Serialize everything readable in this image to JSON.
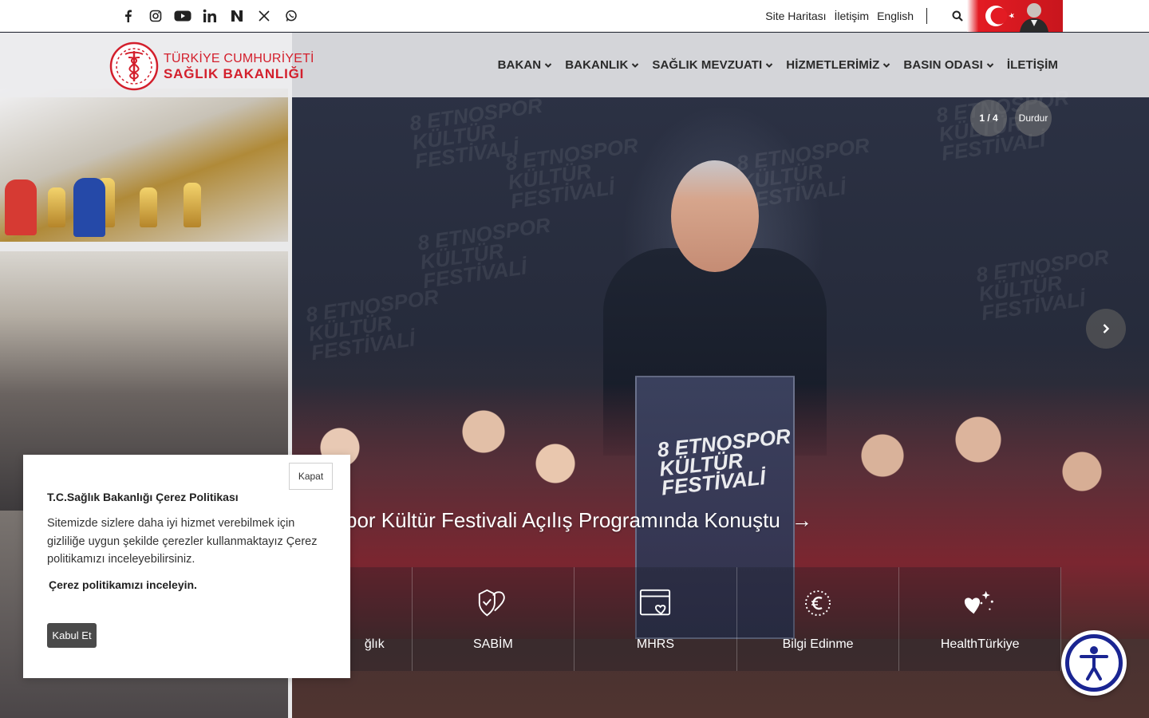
{
  "social": {
    "icons": [
      "facebook-icon",
      "instagram-icon",
      "youtube-icon",
      "linkedin-icon",
      "nsosyal-icon",
      "x-icon",
      "whatsapp-icon"
    ]
  },
  "toplinks": {
    "sitemap": "Site Haritası",
    "contact": "İletişim",
    "english": "English"
  },
  "logo": {
    "line1": "TÜRKİYE CUMHURİYETİ",
    "line2": "SAĞLIK BAKANLIĞI",
    "color": "#d31f2c"
  },
  "nav": {
    "items": [
      {
        "label": "BAKAN",
        "dropdown": true
      },
      {
        "label": "BAKANLIK",
        "dropdown": true
      },
      {
        "label": "SAĞLIK MEVZUATI",
        "dropdown": true
      },
      {
        "label": "HİZMETLERİMİZ",
        "dropdown": true
      },
      {
        "label": "BASIN ODASI",
        "dropdown": true
      },
      {
        "label": "İLETİŞİM",
        "dropdown": false
      }
    ]
  },
  "slider": {
    "counter": "1 / 4",
    "pause_label": "Durdur",
    "caption": "spor Kültür Festivali Açılış Programında Konuştu",
    "caption_arrow": "→"
  },
  "quicklinks": [
    {
      "label": "ğlık",
      "icon": "health-icon"
    },
    {
      "label": "SABİM",
      "icon": "shield-heart-icon"
    },
    {
      "label": "MHRS",
      "icon": "calendar-heart-icon"
    },
    {
      "label": "Bilgi Edinme",
      "icon": "info-c-icon"
    },
    {
      "label": "HealthTürkiye",
      "icon": "star-heart-icon"
    }
  ],
  "cookie": {
    "close_label": "Kapat",
    "title": "T.C.Sağlık Bakanlığı Çerez Politikası",
    "text": "Sitemizde sizlere daha iyi hizmet verebilmek için gizliliğe uygun şekilde çerezler kullanmaktayız Çerez politikamızı inceleyebilirsiniz.",
    "link": "Çerez politikamızı inceleyin.",
    "accept_label": "Kabul Et"
  },
  "colors": {
    "brand_red": "#d31f2c",
    "accessibility_blue": "#1a2592"
  }
}
